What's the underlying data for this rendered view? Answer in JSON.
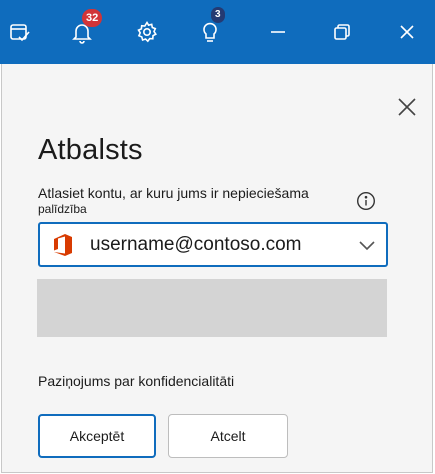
{
  "titlebar": {
    "notifications_count": "32",
    "tips_count": "3",
    "icons": [
      "task-check-icon",
      "bell-icon",
      "gear-icon",
      "lightbulb-icon",
      "minimize-icon",
      "restore-icon",
      "close-icon"
    ],
    "background": "#0f6cbd"
  },
  "panel": {
    "title": "Atbalsts",
    "prompt_line1": "Atlasiet kontu, ar kuru jums ir nepieciešama",
    "prompt_line2": "palīdzība",
    "account": "username@contoso.com",
    "privacy_link": "Paziņojums par konfidencialitāti",
    "accept_label": "Akceptēt",
    "cancel_label": "Atcelt"
  },
  "colors": {
    "accent": "#0f6cbd",
    "badge_red": "#d13438",
    "badge_navy": "#243a73",
    "office_logo": "#d83b01"
  }
}
